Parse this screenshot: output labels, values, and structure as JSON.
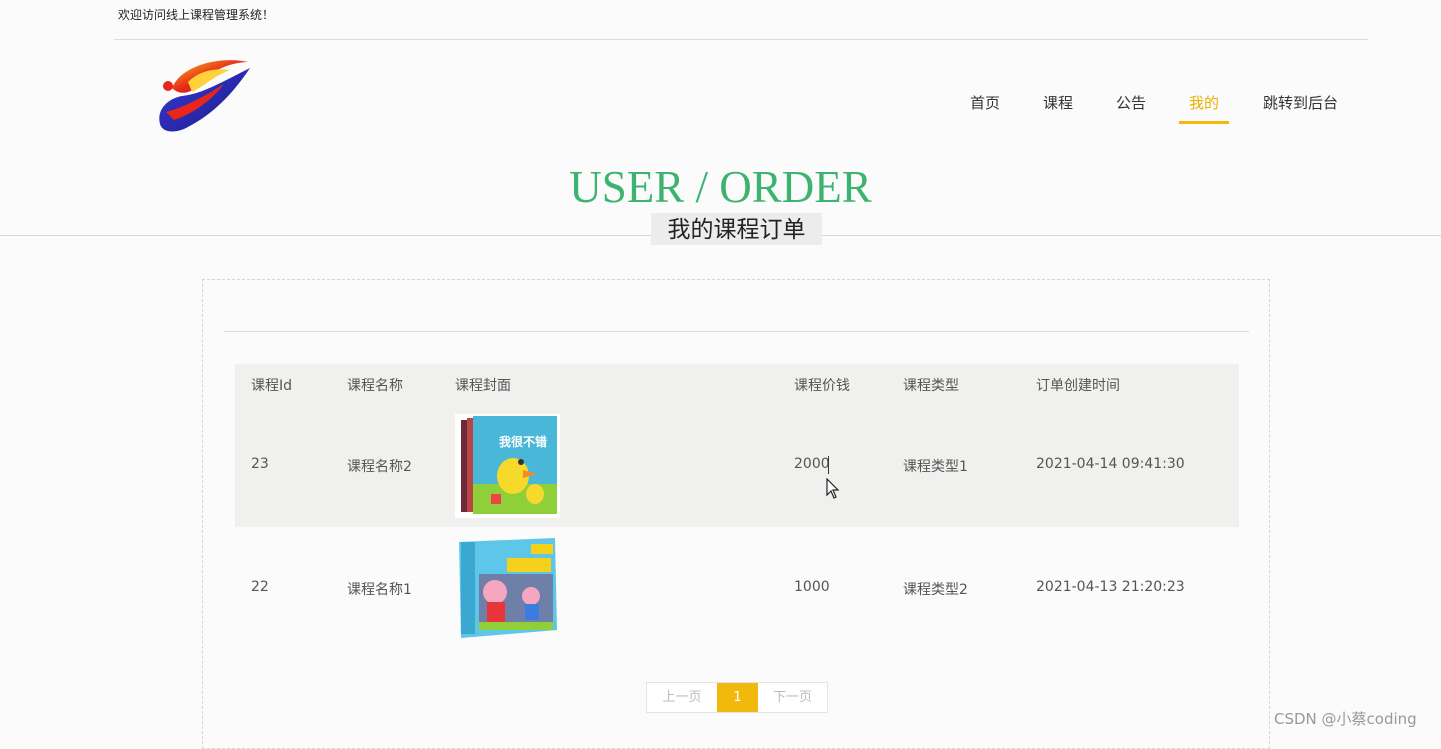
{
  "header": {
    "welcome": "欢迎访问线上课程管理系统！",
    "nav": [
      "首页",
      "课程",
      "公告",
      "我的",
      "跳转到后台"
    ],
    "active_nav": "我的"
  },
  "hero": {
    "title": "USER / ORDER",
    "subtitle": "我的课程订单"
  },
  "table": {
    "columns": [
      "课程Id",
      "课程名称",
      "课程封面",
      "课程价钱",
      "课程类型",
      "订单创建时间"
    ],
    "rows": [
      {
        "id": "23",
        "name": "课程名称2",
        "cover_icon": "course-cover-duck-book",
        "price": "2000",
        "type": "课程类型1",
        "created": "2021-04-14 09:41:30"
      },
      {
        "id": "22",
        "name": "课程名称1",
        "cover_icon": "course-cover-peppa-book",
        "price": "1000",
        "type": "课程类型2",
        "created": "2021-04-13 21:20:23"
      }
    ]
  },
  "pager": {
    "prev": "上一页",
    "current": "1",
    "next": "下一页"
  },
  "watermark": "CSDN @小蔡coding",
  "colors": {
    "accent": "#f0b90b",
    "hero_title": "#3cb371"
  }
}
